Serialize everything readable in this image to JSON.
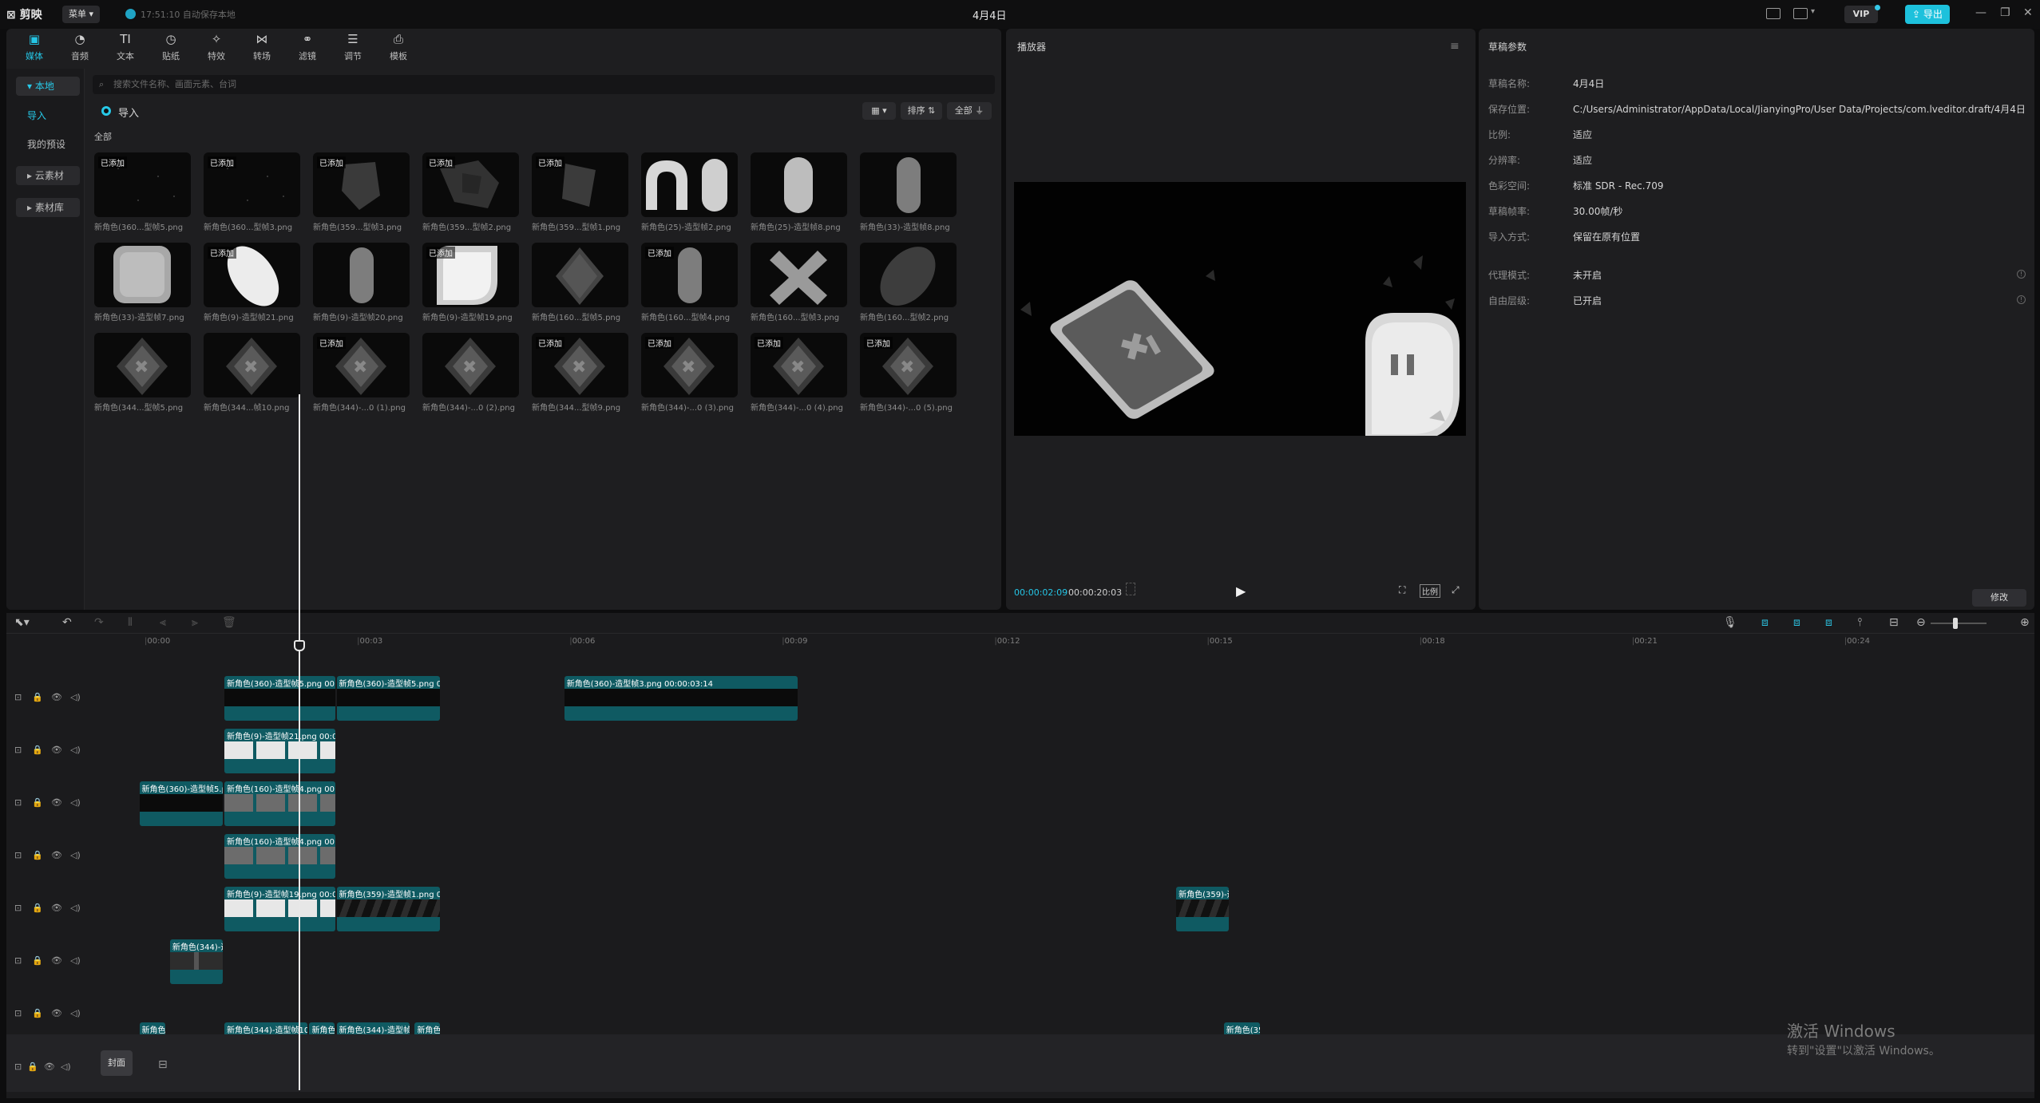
{
  "titlebar": {
    "app_name": "剪映",
    "menu_label": "菜单",
    "autosave_text": "17:51:10 自动保存本地",
    "doc_title": "4月4日",
    "vip_label": "VIP",
    "export_label": "导出"
  },
  "toolbar": [
    {
      "label": "媒体",
      "icon": "media-icon",
      "glyph": "▣"
    },
    {
      "label": "音频",
      "icon": "audio-icon",
      "glyph": "◔"
    },
    {
      "label": "文本",
      "icon": "text-icon",
      "glyph": "TI"
    },
    {
      "label": "贴纸",
      "icon": "sticker-icon",
      "glyph": "◷"
    },
    {
      "label": "特效",
      "icon": "effects-icon",
      "glyph": "✧"
    },
    {
      "label": "转场",
      "icon": "transition-icon",
      "glyph": "⋈"
    },
    {
      "label": "滤镜",
      "icon": "filter-icon",
      "glyph": "⚭"
    },
    {
      "label": "调节",
      "icon": "adjust-icon",
      "glyph": "☰"
    },
    {
      "label": "模板",
      "icon": "template-icon",
      "glyph": "⎙"
    }
  ],
  "sidenav": {
    "local": "本地",
    "import": "导入",
    "presets": "我的预设",
    "cloud": "云素材",
    "library": "素材库"
  },
  "media": {
    "search_placeholder": "搜索文件名称、画面元素、台词",
    "import_label": "导入",
    "sort_label": "排序",
    "all_filter_label": "全部",
    "section_all": "全部",
    "added_tag": "已添加",
    "items": [
      {
        "name": "新角色(360...型帧5.png",
        "added": true,
        "kind": "dots"
      },
      {
        "name": "新角色(360...型帧3.png",
        "added": true,
        "kind": "dots"
      },
      {
        "name": "新角色(359...型帧3.png",
        "added": true,
        "kind": "shard"
      },
      {
        "name": "新角色(359...型帧2.png",
        "added": true,
        "kind": "shard2"
      },
      {
        "name": "新角色(359...型帧1.png",
        "added": true,
        "kind": "shard3"
      },
      {
        "name": "新角色(25)-造型帧2.png",
        "added": false,
        "kind": "arch"
      },
      {
        "name": "新角色(25)-造型帧8.png",
        "added": false,
        "kind": "pill"
      },
      {
        "name": "新角色(33)-造型帧8.png",
        "added": false,
        "kind": "pillgray"
      },
      {
        "name": "新角色(33)-造型帧7.png",
        "added": false,
        "kind": "square"
      },
      {
        "name": "新角色(9)-造型帧21.png",
        "added": true,
        "kind": "leaf"
      },
      {
        "name": "新角色(9)-造型帧20.png",
        "added": false,
        "kind": "pillgray"
      },
      {
        "name": "新角色(9)-造型帧19.png",
        "added": true,
        "kind": "corner"
      },
      {
        "name": "新角色(160...型帧5.png",
        "added": false,
        "kind": "diamond"
      },
      {
        "name": "新角色(160...型帧4.png",
        "added": true,
        "kind": "pillgray"
      },
      {
        "name": "新角色(160...型帧3.png",
        "added": false,
        "kind": "x"
      },
      {
        "name": "新角色(160...型帧2.png",
        "added": false,
        "kind": "oval"
      },
      {
        "name": "新角色(344...型帧5.png",
        "added": false,
        "kind": "dx"
      },
      {
        "name": "新角色(344...帧10.png",
        "added": false,
        "kind": "dx"
      },
      {
        "name": "新角色(344)-...0 (1).png",
        "added": true,
        "kind": "dx"
      },
      {
        "name": "新角色(344)-...0 (2).png",
        "added": false,
        "kind": "dx"
      },
      {
        "name": "新角色(344...型帧9.png",
        "added": true,
        "kind": "dx"
      },
      {
        "name": "新角色(344)-...0 (3).png",
        "added": true,
        "kind": "dx"
      },
      {
        "name": "新角色(344)-...0 (4).png",
        "added": true,
        "kind": "dx"
      },
      {
        "name": "新角色(344)-...0 (5).png",
        "added": true,
        "kind": "dx"
      }
    ]
  },
  "player": {
    "title": "播放器",
    "current_time": "00:00:02:09",
    "total_time": "00:00:20:03",
    "ratio_label": "比例"
  },
  "draft": {
    "title": "草稿参数",
    "rows": [
      {
        "key": "草稿名称:",
        "value": "4月4日"
      },
      {
        "key": "保存位置:",
        "value": "C:/Users/Administrator/AppData/Local/JianyingPro/User Data/Projects/com.lveditor.draft/4月4日"
      },
      {
        "key": "比例:",
        "value": "适应"
      },
      {
        "key": "分辨率:",
        "value": "适应"
      },
      {
        "key": "色彩空间:",
        "value": "标准 SDR - Rec.709"
      },
      {
        "key": "草稿帧率:",
        "value": "30.00帧/秒"
      },
      {
        "key": "导入方式:",
        "value": "保留在原有位置"
      }
    ],
    "rows2": [
      {
        "key": "代理模式:",
        "value": "未开启"
      },
      {
        "key": "自由层级:",
        "value": "已开启"
      }
    ],
    "modify_label": "修改"
  },
  "timeline": {
    "ruler": [
      "00:00",
      "00:03",
      "00:06",
      "00:09",
      "00:12",
      "00:15",
      "00:18",
      "00:21",
      "00:24"
    ],
    "cover_label": "封面",
    "tracks": [
      {
        "clips": [
          {
            "label": "新角色(360)-造型帧5.png  00:0",
            "style": "dark",
            "start": 0.0,
            "dur": 1.65
          },
          {
            "label": "新角色(360)-造型帧5.png  00:",
            "style": "dark",
            "start": 1.65,
            "dur": 1.55
          },
          {
            "label": "新角色(360)-造型帧3.png  00:00:03:14",
            "style": "dark",
            "start": 5.0,
            "dur": 3.45
          }
        ]
      },
      {
        "clips": [
          {
            "label": "新角色(9)-造型帧21.png  00:00",
            "style": "white",
            "start": 0.0,
            "dur": 1.65
          }
        ]
      },
      {
        "clips": [
          {
            "label": "新角色(360)-造型帧5.p",
            "style": "dark",
            "start": -1.25,
            "dur": 1.25
          },
          {
            "label": "新角色(160)-造型帧4.png  00:0",
            "style": "gray",
            "start": 0.0,
            "dur": 1.65
          }
        ]
      },
      {
        "clips": [
          {
            "label": "新角色(160)-造型帧4.png  00:0",
            "style": "gray",
            "start": 0.0,
            "dur": 1.65
          }
        ]
      },
      {
        "clips": [
          {
            "label": "新角色(9)-造型帧19.png  00:00",
            "style": "white",
            "start": 0.0,
            "dur": 1.65
          },
          {
            "label": "新角色(359)-造型帧1.png  00",
            "style": "stripe",
            "start": 1.65,
            "dur": 1.55
          },
          {
            "label": "新角色(359)-造",
            "style": "stripe",
            "start": 14.0,
            "dur": 0.8
          }
        ]
      },
      {
        "clips": [
          {
            "label": "新角色(344)-造",
            "style": "diamond",
            "start": -0.8,
            "dur": 0.8
          }
        ]
      },
      {
        "clips": [
          {
            "label": "新角色",
            "style": "short",
            "start": -1.25,
            "dur": 0.4
          },
          {
            "label": "新角色(344)-造型帧10",
            "style": "short",
            "start": 0.0,
            "dur": 1.25
          },
          {
            "label": "新角色",
            "style": "short",
            "start": 1.25,
            "dur": 0.4
          },
          {
            "label": "新角色(344)-造型帧1)",
            "style": "short",
            "start": 1.65,
            "dur": 1.1
          },
          {
            "label": "新角色",
            "style": "short",
            "start": 2.8,
            "dur": 0.4
          },
          {
            "label": "新角色(35",
            "style": "short",
            "start": 14.7,
            "dur": 0.55
          }
        ]
      }
    ]
  },
  "watermark": {
    "line1": "激活 Windows",
    "line2": "转到\"设置\"以激活 Windows。"
  }
}
